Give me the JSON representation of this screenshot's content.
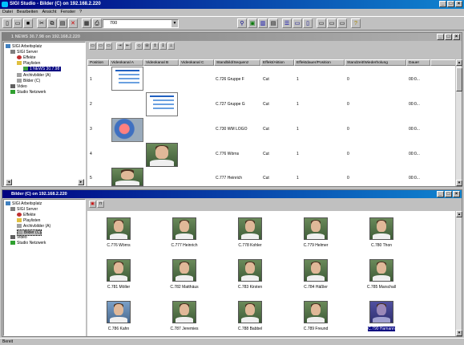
{
  "app": {
    "title": "SIGI Studio - Bilder (C) on 192.168.2.220",
    "controls": [
      "_",
      "□",
      "×"
    ]
  },
  "menu": [
    "Datei",
    "Bearbeiten",
    "Ansicht",
    "Fenster",
    "?"
  ],
  "toolbar": {
    "zoom_value": "700"
  },
  "win1": {
    "title": "1 NEWS 30.7.98 on 192.168.2.220",
    "tree": [
      "SIGI Arbeitsplatz",
      "SIGI Server",
      "Effekte",
      "Playlisten",
      "1 NEWS 30.7.98",
      "Archivbilder (A)",
      "Bilder (C)",
      "Video",
      "Studio Netzwerk"
    ],
    "columns": [
      "Position",
      "Videokanal A",
      "Videokanal B",
      "Videokanal C",
      "Standbild/Sequenz",
      "Effekt/Aktion",
      "Effektdauer/Position",
      "Standzeit/Wiederholung",
      "Dauer"
    ],
    "rows": [
      {
        "pos": "1",
        "still": "C.726 Gruppe F",
        "effect": "Cut",
        "dur": "1",
        "stand": "0",
        "dauer": "00:0..."
      },
      {
        "pos": "2",
        "still": "C.727 Gruppe G",
        "effect": "Cut",
        "dur": "1",
        "stand": "0",
        "dauer": "00:0..."
      },
      {
        "pos": "3",
        "still": "C.730 WM LOGO",
        "effect": "Cut",
        "dur": "1",
        "stand": "0",
        "dauer": "00:0..."
      },
      {
        "pos": "4",
        "still": "C.776 Wörns",
        "effect": "Cut",
        "dur": "1",
        "stand": "0",
        "dauer": "00:0..."
      },
      {
        "pos": "5",
        "still": "C.777 Heinrich",
        "effect": "Cut",
        "dur": "1",
        "stand": "0",
        "dauer": "00:0..."
      }
    ]
  },
  "win2": {
    "title": "Bilder (C) on 192.168.2.220",
    "tree": [
      "SIGI Arbeitsplatz",
      "SIGI Server",
      "Effekte",
      "Playlisten",
      "Archivbilder (A)",
      "Bilder (C)",
      "Video",
      "Studio Netzwerk"
    ],
    "thumbs": [
      "C.776 Wörns",
      "C.777 Heinrich",
      "C.778 Kohler",
      "C.779 Helmer",
      "C.780 Thon",
      "C.781 Möller",
      "C.782 Matthäus",
      "C.783 Kirsten",
      "C.784 Häßler",
      "C.785 Marschall",
      "C.786 Kahn",
      "C.787 Jeremies",
      "C.788 Babbel",
      "C.789 Freund",
      "C.790 Hamann"
    ]
  },
  "status": {
    "text": "Bereit"
  }
}
